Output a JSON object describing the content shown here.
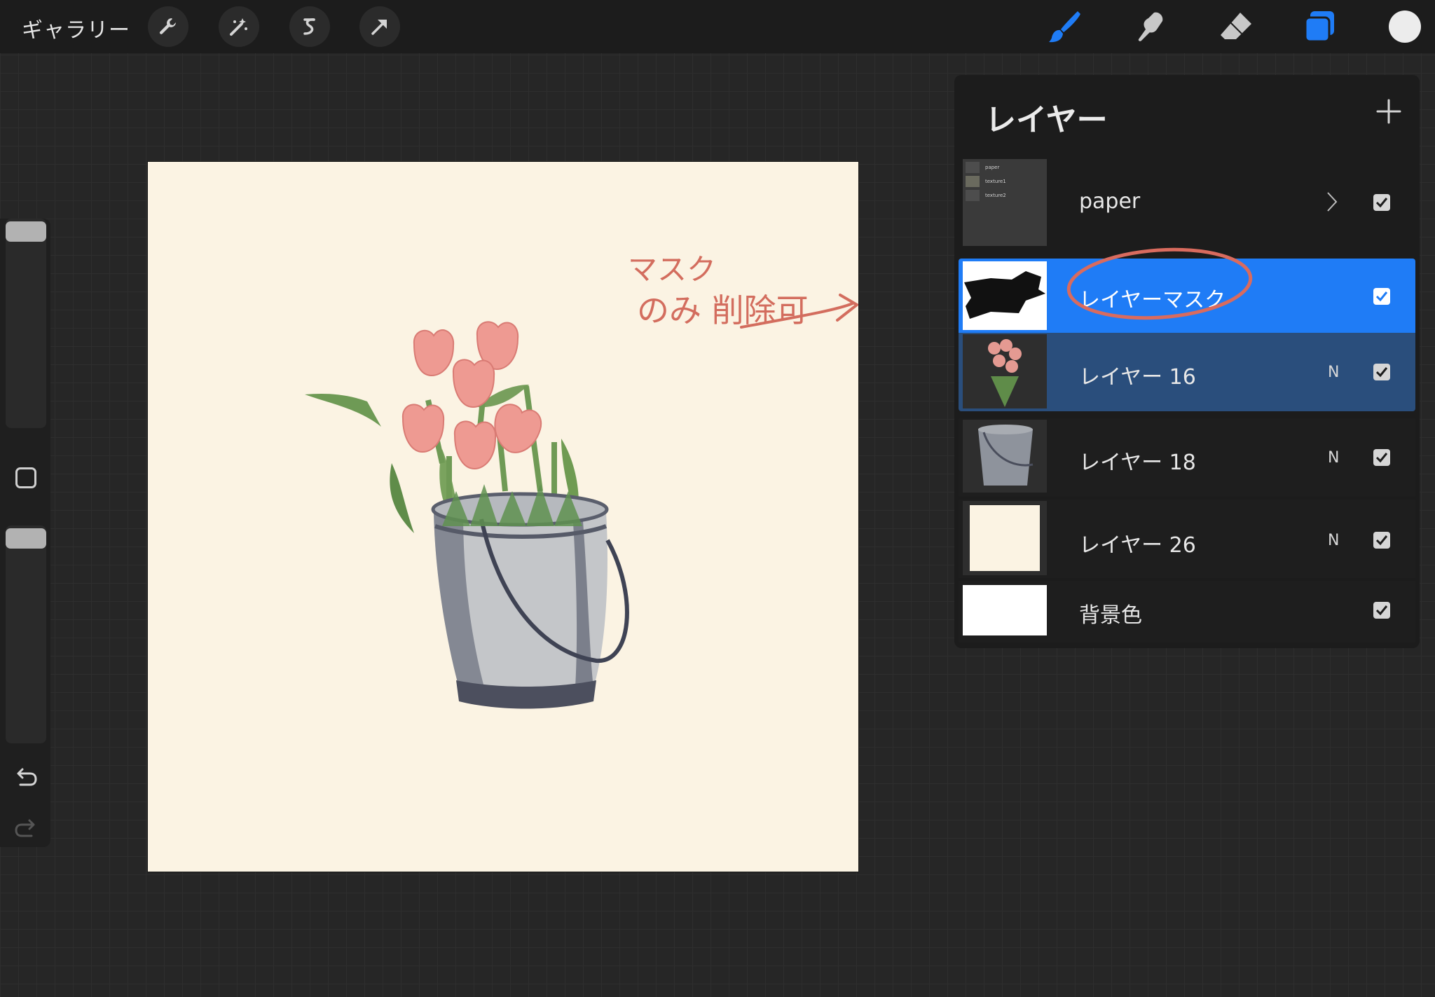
{
  "toolbar": {
    "gallery_label": "ギャラリー",
    "left_tools": [
      "wrench-icon",
      "magic-wand-icon",
      "selection-icon",
      "transform-arrow-icon"
    ],
    "right_tools": [
      "brush-icon",
      "smudge-icon",
      "eraser-icon",
      "layers-icon"
    ],
    "accent_color": "#1f7cf6",
    "current_color": "#ececec"
  },
  "sidebar": {
    "icons": [
      "brush-size-slider",
      "modify-square-button",
      "opacity-slider",
      "undo-icon",
      "redo-icon"
    ]
  },
  "canvas": {
    "background_color": "#fbf3e3",
    "annotation": {
      "line1": "マスク",
      "line2": "のみ 削除可",
      "color": "#d36d5e"
    }
  },
  "layers_panel": {
    "title": "レイヤー",
    "add_icon": "plus-icon",
    "group_sublayers": [
      "paper",
      "texture1",
      "texture2"
    ],
    "layers": [
      {
        "name": "paper",
        "type": "group",
        "blend": "",
        "visible": true
      },
      {
        "name": "レイヤーマスク",
        "type": "mask",
        "blend": "",
        "visible": true,
        "state": "selected"
      },
      {
        "name": "レイヤー 16",
        "type": "layer",
        "blend": "N",
        "visible": true,
        "state": "secondary-selected"
      },
      {
        "name": "レイヤー 18",
        "type": "layer",
        "blend": "N",
        "visible": true
      },
      {
        "name": "レイヤー 26",
        "type": "layer",
        "blend": "N",
        "visible": true
      },
      {
        "name": "背景色",
        "type": "background",
        "blend": "",
        "visible": true
      }
    ],
    "colors": {
      "selected": "#1f7cf6",
      "secondary_selected": "#2a4e7c",
      "row": "#1c1c1c"
    }
  }
}
